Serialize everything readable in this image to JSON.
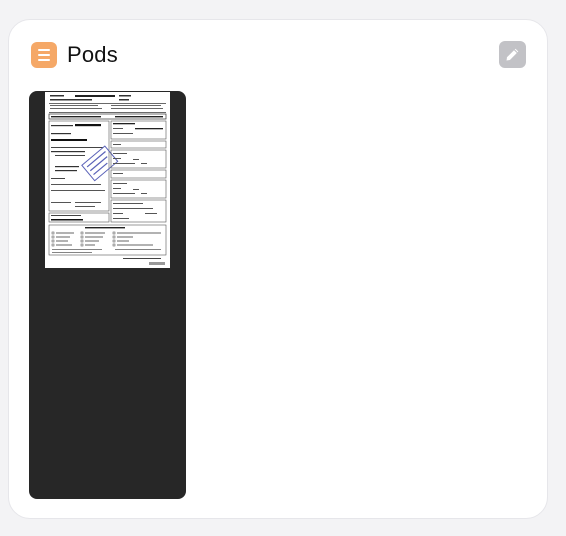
{
  "pods_card": {
    "title": "Pods",
    "icon": "list-icon",
    "accent_color": "#f5a867",
    "edit_icon": "pencil-icon"
  },
  "documents": [
    {
      "kind": "scanned-delivery-receipt",
      "icon": "document-thumbnail"
    }
  ]
}
